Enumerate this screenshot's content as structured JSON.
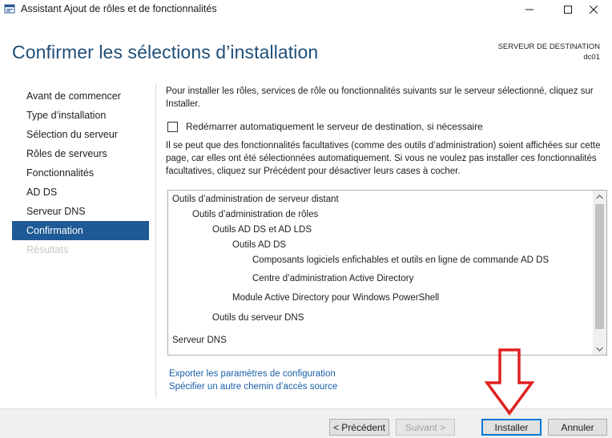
{
  "window": {
    "title": "Assistant Ajout de rôles et de fonctionnalités"
  },
  "header": {
    "title": "Confirmer les sélections d’installation",
    "destination_label": "SERVEUR DE DESTINATION",
    "destination_server": "dc01"
  },
  "nav": {
    "items": [
      {
        "label": "Avant de commencer",
        "state": "normal"
      },
      {
        "label": "Type d’installation",
        "state": "normal"
      },
      {
        "label": "Sélection du serveur",
        "state": "normal"
      },
      {
        "label": "Rôles de serveurs",
        "state": "normal"
      },
      {
        "label": "Fonctionnalités",
        "state": "normal"
      },
      {
        "label": "AD DS",
        "state": "normal"
      },
      {
        "label": "Serveur DNS",
        "state": "normal"
      },
      {
        "label": "Confirmation",
        "state": "active"
      },
      {
        "label": "Résultats",
        "state": "disabled"
      }
    ]
  },
  "content": {
    "intro": "Pour installer les rôles, services de rôle ou fonctionnalités suivants sur le serveur sélectionné, cliquez sur Installer.",
    "restart_checkbox": {
      "label": "Redémarrer automatiquement le serveur de destination, si nécessaire",
      "checked": false
    },
    "note": "Il se peut que des fonctionnalités facultatives (comme des outils d’administration) soient affichées sur cette page, car elles ont été sélectionnées automatiquement. Si vous ne voulez pas installer ces fonctionnalités facultatives, cliquez sur Précédent pour désactiver leurs cases à cocher.",
    "selections": [
      {
        "label": "Outils d’administration de serveur distant",
        "level": 0
      },
      {
        "label": "Outils d’administration de rôles",
        "level": 1
      },
      {
        "label": "Outils AD DS et AD LDS",
        "level": 2
      },
      {
        "label": "Outils AD DS",
        "level": 3
      },
      {
        "label": "Composants logiciels enfichables et outils en ligne de commande AD DS",
        "level": 4
      },
      {
        "label": "Centre d’administration Active Directory",
        "level": 4
      },
      {
        "label": "Module Active Directory pour Windows PowerShell",
        "level": 3
      },
      {
        "label": "Outils du serveur DNS",
        "level": 2
      },
      {
        "label": "Serveur DNS",
        "level": 0
      }
    ],
    "links": {
      "export": "Exporter les paramètres de configuration",
      "alternate_source": "Spécifier un autre chemin d’accès source"
    }
  },
  "footer": {
    "previous": "< Précédent",
    "next": "Suivant >",
    "install": "Installer",
    "cancel": "Annuler"
  },
  "colors": {
    "title_blue": "#1e4e79",
    "nav_active": "#1f5a96",
    "link_blue": "#1a5fa8",
    "annotation_arrow": "#e02020"
  }
}
